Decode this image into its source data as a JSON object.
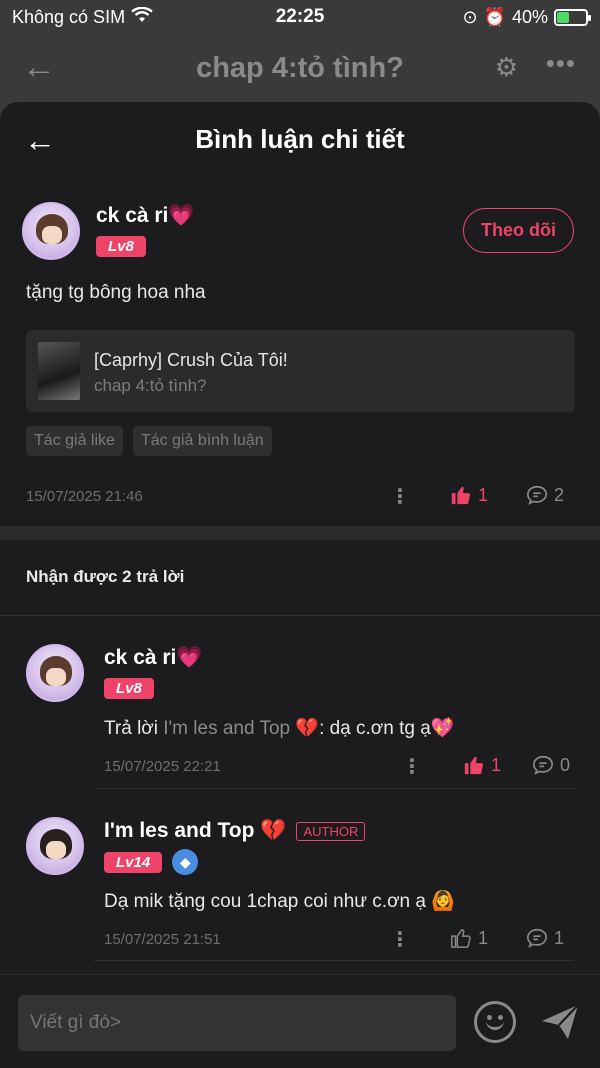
{
  "status_bar": {
    "carrier": "Không có SIM",
    "time": "22:25",
    "battery": "40%"
  },
  "bg_header": {
    "title": "chap 4:tỏ tình?"
  },
  "sheet": {
    "title": "Bình luận chi tiết"
  },
  "main_comment": {
    "username": "ck cà ri💗",
    "level": "Lv8",
    "follow_label": "Theo dõi",
    "text": "tặng tg bông hoa nha",
    "chapter": {
      "title": "[Caprhy] Crush Của Tôi!",
      "subtitle": "chap 4:tỏ tình?"
    },
    "tags": [
      "Tác giả like",
      "Tác giả bình luận"
    ],
    "date": "15/07/2025 21:46",
    "likes": "1",
    "replies": "2"
  },
  "replies_header": "Nhận được 2 trả lời",
  "replies": [
    {
      "username": "ck cà ri💗",
      "level": "Lv8",
      "reply_prefix": "Trả lời ",
      "mention": "I'm les and Top 💔",
      "text": ": dạ c.ơn tg ạ💖",
      "date": "15/07/2025 22:21",
      "likes": "1",
      "replies": "0"
    },
    {
      "username": "I'm les and Top 💔",
      "author_badge": "AUTHOR",
      "level": "Lv14",
      "text": "Dạ mik tặng cou 1chap coi như c.ơn ạ 🙆",
      "date": "15/07/2025 21:51",
      "likes": "1",
      "replies": "1"
    }
  ],
  "composer": {
    "placeholder": "Viết gì đó>"
  },
  "colors": {
    "accent": "#f0436a",
    "sheet_bg": "#1c1c1e",
    "muted": "#8a8a8a"
  }
}
